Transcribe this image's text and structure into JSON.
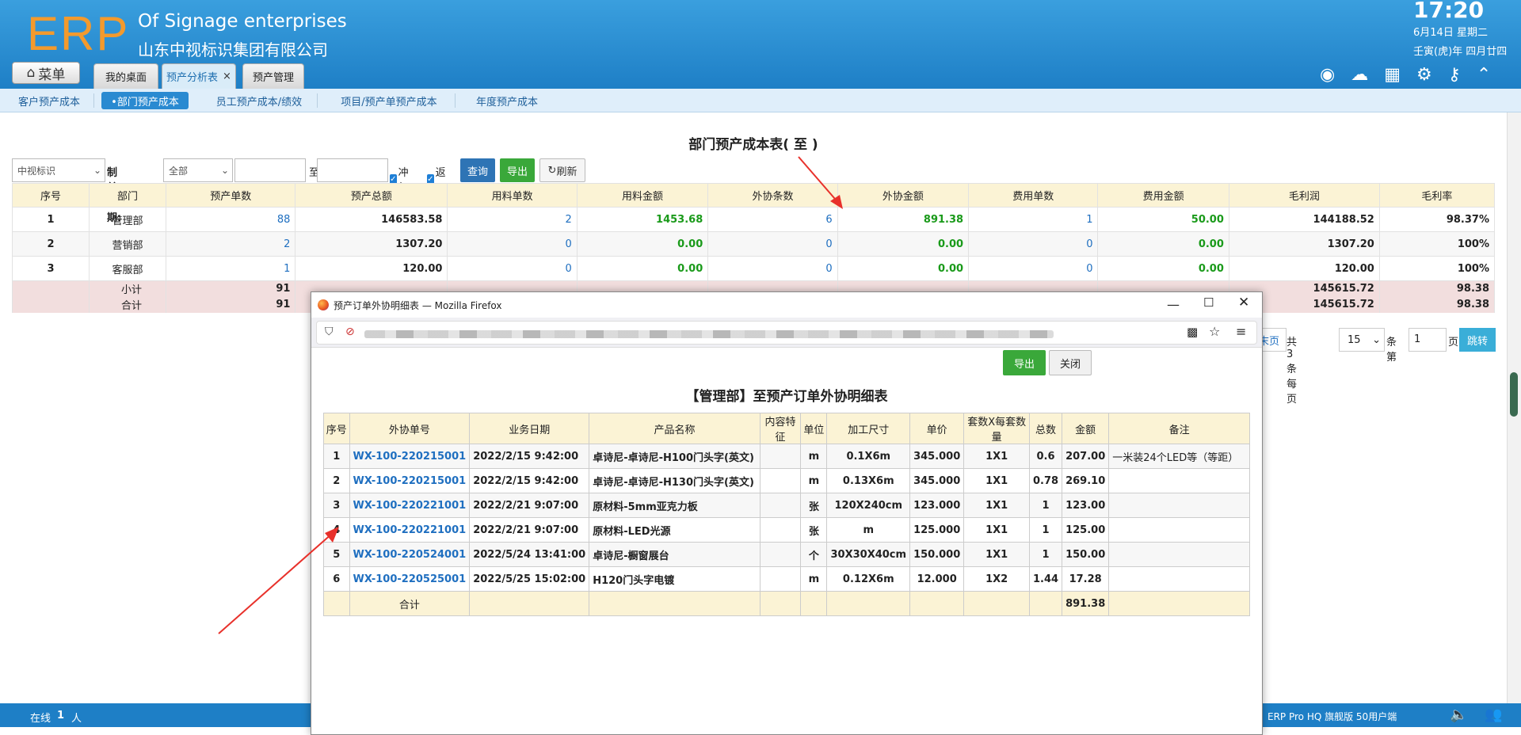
{
  "header": {
    "logo": "ERP",
    "company_en": "Of Signage enterprises",
    "company_cn": "山东中视标识集团有限公司",
    "time": "17:20",
    "date": "6月14日 星期二",
    "lunar": "壬寅(虎)年 四月廿四",
    "menu_label": "菜单",
    "tabs": [
      {
        "label": "我的桌面"
      },
      {
        "label": "预产分析表",
        "close": "×"
      },
      {
        "label": "预产管理"
      }
    ],
    "icons": [
      "user-icon",
      "cloud-icon",
      "apps-icon",
      "gear-icon",
      "key-icon",
      "up-icon"
    ]
  },
  "subnav": [
    "客户预产成本",
    "•部门预产成本",
    "员工预产成本/绩效",
    "项目/预产单预产成本",
    "年度预产成本"
  ],
  "report": {
    "title": "部门预产成本表( 至 )",
    "filters": {
      "company": "中视标识",
      "date_label": "制单日期:",
      "date_type": "全部",
      "to": "至",
      "check1": "冲红",
      "check2": "返工",
      "query": "查询",
      "export": "导出",
      "refresh": "刷新"
    },
    "columns": [
      "序号",
      "部门",
      "预产单数",
      "预产总额",
      "用料单数",
      "用料金额",
      "外协条数",
      "外协金额",
      "费用单数",
      "费用金额",
      "毛利润",
      "毛利率"
    ],
    "rows": [
      [
        "1",
        "管理部",
        "88",
        "146583.58",
        "2",
        "1453.68",
        "6",
        "891.38",
        "1",
        "50.00",
        "144188.52",
        "98.37%"
      ],
      [
        "2",
        "营销部",
        "2",
        "1307.20",
        "0",
        "0.00",
        "0",
        "0.00",
        "0",
        "0.00",
        "1307.20",
        "100%"
      ],
      [
        "3",
        "客服部",
        "1",
        "120.00",
        "0",
        "0.00",
        "0",
        "0.00",
        "0",
        "0.00",
        "120.00",
        "100%"
      ]
    ],
    "subtotal_label": "小计",
    "total_label": "合计",
    "subtotal_partial": "91",
    "total_partial": "91",
    "subtotal_profit": "145615.72",
    "total_profit": "145615.72",
    "subtotal_rate": "98.38",
    "total_rate": "98.38",
    "pager": {
      "last": "末页",
      "count": "共3条每页",
      "per_page": "15",
      "unit": "条第",
      "page": "1",
      "page_unit": "页",
      "jump": "跳转"
    }
  },
  "status": {
    "online_label": "在线",
    "online_count": "1",
    "online_unit": "人",
    "version": "ERP Pro HQ 旗舰版 50用户端"
  },
  "popup": {
    "window_title": "预产订单外协明细表 — Mozilla Firefox",
    "export": "导出",
    "close": "关闭",
    "title": "【管理部】至预产订单外协明细表",
    "columns": [
      "序号",
      "外协单号",
      "业务日期",
      "产品名称",
      "内容特征",
      "单位",
      "加工尺寸",
      "单价",
      "套数X每套数量",
      "总数",
      "金额",
      "备注"
    ],
    "rows": [
      [
        "1",
        "WX-100-220215001",
        "2022/2/15 9:42:00",
        "卓诗尼-卓诗尼-H100门头字(英文)",
        "",
        "m",
        "0.1X6m",
        "345.000",
        "1X1",
        "0.6",
        "207.00",
        "一米装24个LED等（等距）"
      ],
      [
        "2",
        "WX-100-220215001",
        "2022/2/15 9:42:00",
        "卓诗尼-卓诗尼-H130门头字(英文)",
        "",
        "m",
        "0.13X6m",
        "345.000",
        "1X1",
        "0.78",
        "269.10",
        ""
      ],
      [
        "3",
        "WX-100-220221001",
        "2022/2/21 9:07:00",
        "原材料-5mm亚克力板",
        "",
        "张",
        "120X240cm",
        "123.000",
        "1X1",
        "1",
        "123.00",
        ""
      ],
      [
        "4",
        "WX-100-220221001",
        "2022/2/21 9:07:00",
        "原材料-LED光源",
        "",
        "张",
        "m",
        "125.000",
        "1X1",
        "1",
        "125.00",
        ""
      ],
      [
        "5",
        "WX-100-220524001",
        "2022/5/24 13:41:00",
        "卓诗尼-橱窗展台",
        "",
        "个",
        "30X30X40cm",
        "150.000",
        "1X1",
        "1",
        "150.00",
        ""
      ],
      [
        "6",
        "WX-100-220525001",
        "2022/5/25 15:02:00",
        "H120门头字电镀",
        "",
        "m",
        "0.12X6m",
        "12.000",
        "1X2",
        "1.44",
        "17.28",
        ""
      ]
    ],
    "total_label": "合计",
    "total_amount": "891.38"
  },
  "colors": {
    "header": "#1e7fc6",
    "accent": "#2a8ad1",
    "green": "#1a9a1a",
    "arrow": "#e8312b"
  }
}
